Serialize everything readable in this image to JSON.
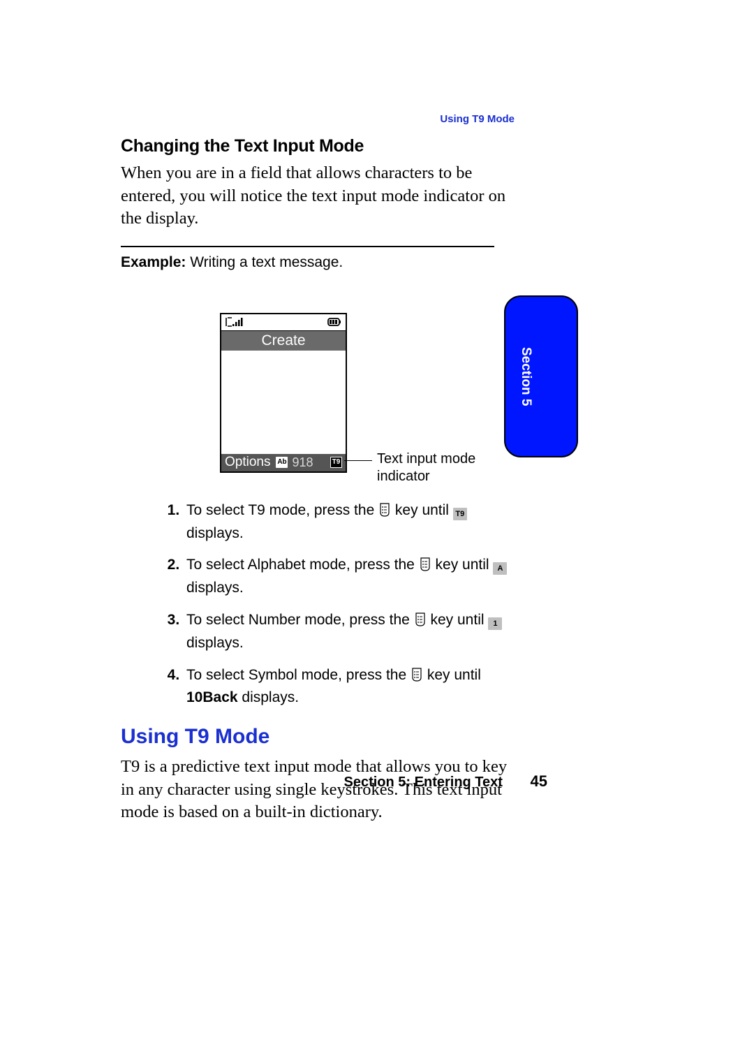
{
  "running_header": "Using T9 Mode",
  "subheading": "Changing the Text Input Mode",
  "intro": "When you are in a field that allows characters to be entered, you will notice the text input mode indicator on the display.",
  "example_label": "Example:",
  "example_text": " Writing a text message.",
  "phone": {
    "title": "Create",
    "softkey_left": "Options",
    "ab_icon_label": "Ab",
    "char_count": "918",
    "t9_icon_label": "T9"
  },
  "callout": "Text input mode indicator",
  "section_tab": "Section 5",
  "steps": [
    {
      "pre": "To select T9 mode, press the ",
      "mid": " key until ",
      "chip": "T9",
      "post": "  displays."
    },
    {
      "pre": "To select Alphabet mode, press the ",
      "mid": " key until ",
      "chip": "A",
      "post": " displays."
    },
    {
      "pre": "To select Number mode, press the ",
      "mid": " key until ",
      "chip": "1",
      "post": " displays."
    },
    {
      "pre": "To select Symbol mode, press the ",
      "mid": " key until ",
      "bold": "10Back",
      "post": " displays."
    }
  ],
  "h2": "Using T9 Mode",
  "t9_intro": "T9 is a predictive text input mode that allows you to key in any character using single keystrokes. This text input mode is based on a built-in dictionary.",
  "footer_section": "Section 5: Entering Text",
  "page_number": "45"
}
